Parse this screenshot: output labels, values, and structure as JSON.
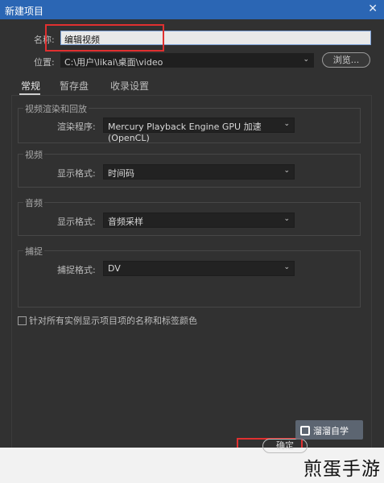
{
  "window": {
    "title": "新建项目",
    "close_glyph": "✕"
  },
  "name": {
    "label": "名称:",
    "value": "编辑视频"
  },
  "location": {
    "label": "位置:",
    "value": "C:\\用户\\likai\\桌面\\video",
    "browse_label": "浏览..."
  },
  "tabs": [
    {
      "label": "常规",
      "active": true
    },
    {
      "label": "暂存盘",
      "active": false
    },
    {
      "label": "收录设置",
      "active": false
    }
  ],
  "groups": {
    "video_render": {
      "title": "视频渲染和回放",
      "row_label": "渲染程序:",
      "value": "Mercury Playback Engine GPU 加速 (OpenCL)"
    },
    "video": {
      "title": "视频",
      "row_label": "显示格式:",
      "value": "时间码"
    },
    "audio": {
      "title": "音频",
      "row_label": "显示格式:",
      "value": "音频采样"
    },
    "capture": {
      "title": "捕捉",
      "row_label": "捕捉格式:",
      "value": "DV"
    }
  },
  "checkbox": {
    "label": "针对所有实例显示项目项的名称和标签颜色",
    "checked": false
  },
  "buttons": {
    "ok_label": "确定"
  },
  "watermark": {
    "text": "溜溜自学"
  },
  "brand": {
    "text": "煎蛋手游"
  },
  "colors": {
    "titlebar": "#2b66b4",
    "dialog_bg": "#313131",
    "highlight": "#e03030"
  },
  "icons": {
    "dropdown": "chevron-down-icon",
    "close": "close-icon",
    "checkbox": "checkbox-icon"
  }
}
